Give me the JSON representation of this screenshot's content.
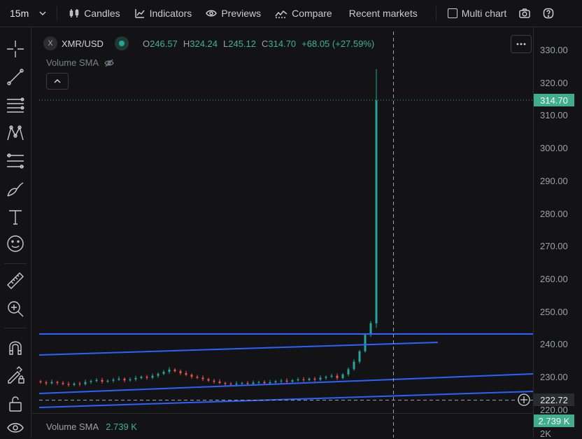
{
  "toolbar": {
    "interval": "15m",
    "candles_label": "Candles",
    "indicators_label": "Indicators",
    "previews_label": "Previews",
    "compare_label": "Compare",
    "recent_markets_label": "Recent markets",
    "multi_chart_label": "Multi chart"
  },
  "left_tools": [
    "crosshair-icon",
    "trend-line-icon",
    "horizontal-lines-icon",
    "pattern-icon",
    "fib-icon",
    "brush-icon",
    "text-icon",
    "emoji-icon",
    "ruler-icon",
    "zoom-in-icon",
    "magnet-icon",
    "pencil-lock-icon",
    "lock-icon",
    "eye-icon"
  ],
  "legend": {
    "symbol_icon": "X",
    "symbol": "XMR/USD",
    "o_label": "O",
    "o_value": "246.57",
    "h_label": "H",
    "h_value": "324.24",
    "l_label": "L",
    "l_value": "245.12",
    "c_label": "C",
    "c_value": "314.70",
    "change": "+68.05 (+27.59%)"
  },
  "indicator": {
    "label": "Volume SMA"
  },
  "volume": {
    "label": "Volume SMA",
    "value": "2.739 K"
  },
  "price_axis": {
    "labels": [
      "330.00",
      "320.00",
      "310.00",
      "300.00",
      "290.00",
      "280.00",
      "270.00",
      "260.00",
      "250.00",
      "240.00",
      "230.00",
      "220.00"
    ],
    "last_price": "314.70",
    "crosshair_price": "222.72",
    "volume_badge": "2.739 K",
    "volume_axis_label": "2K"
  },
  "colors": {
    "up": "#26a69a",
    "down": "#ef5350",
    "trendline": "#2962ff",
    "badge_green": "#3fae8a",
    "background": "#131316"
  },
  "chart_data": {
    "type": "candlestick",
    "symbol": "XMR/USD",
    "interval": "15m",
    "ylim": [
      219,
      333
    ],
    "y_ticks": [
      220,
      230,
      240,
      250,
      260,
      270,
      280,
      290,
      300,
      310,
      320,
      330
    ],
    "last_candle": {
      "open": 246.57,
      "high": 324.24,
      "low": 245.12,
      "close": 314.7
    },
    "approx_closes": [
      228.5,
      228.2,
      228.6,
      228.3,
      228.0,
      227.7,
      228.1,
      227.9,
      228.6,
      228.9,
      229.2,
      228.7,
      229.0,
      229.3,
      229.6,
      229.1,
      229.4,
      229.8,
      230.2,
      229.9,
      230.5,
      231.1,
      231.7,
      232.4,
      231.9,
      231.3,
      230.8,
      230.2,
      229.9,
      229.5,
      229.0,
      228.7,
      228.3,
      228.0,
      227.8,
      228.1,
      228.3,
      228.0,
      228.4,
      228.6,
      228.2,
      228.5,
      228.8,
      229.0,
      228.7,
      229.1,
      229.4,
      229.2,
      229.6,
      229.3,
      229.9,
      230.2,
      230.5,
      229.8,
      230.9,
      232.5,
      234.8,
      238.0,
      243.0,
      246.57,
      314.7
    ]
  }
}
